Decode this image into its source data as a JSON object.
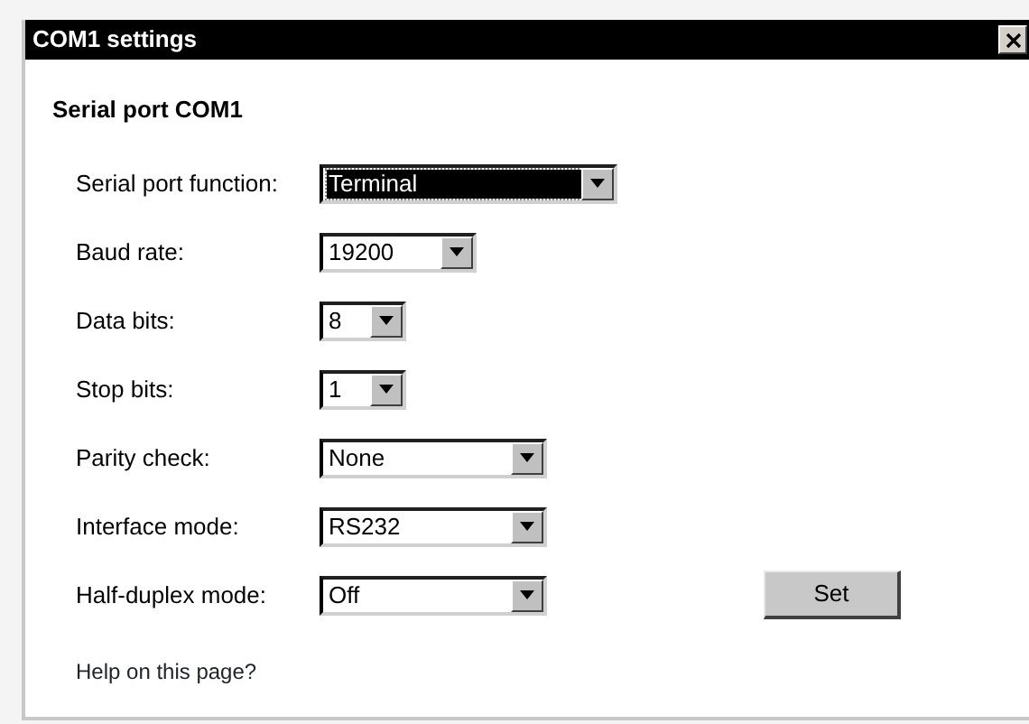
{
  "window": {
    "title": "COM1 settings"
  },
  "heading": "Serial port COM1",
  "fields": [
    {
      "label": "Serial port function:",
      "value": "Terminal",
      "focused": true
    },
    {
      "label": "Baud rate:",
      "value": "19200",
      "focused": false
    },
    {
      "label": "Data bits:",
      "value": "8",
      "focused": false
    },
    {
      "label": "Stop bits:",
      "value": "1",
      "focused": false
    },
    {
      "label": "Parity check:",
      "value": "None",
      "focused": false
    },
    {
      "label": "Interface mode:",
      "value": "RS232",
      "focused": false
    },
    {
      "label": "Half-duplex mode:",
      "value": "Off",
      "focused": false
    }
  ],
  "set_button": "Set",
  "help_link": "Help on this page?"
}
